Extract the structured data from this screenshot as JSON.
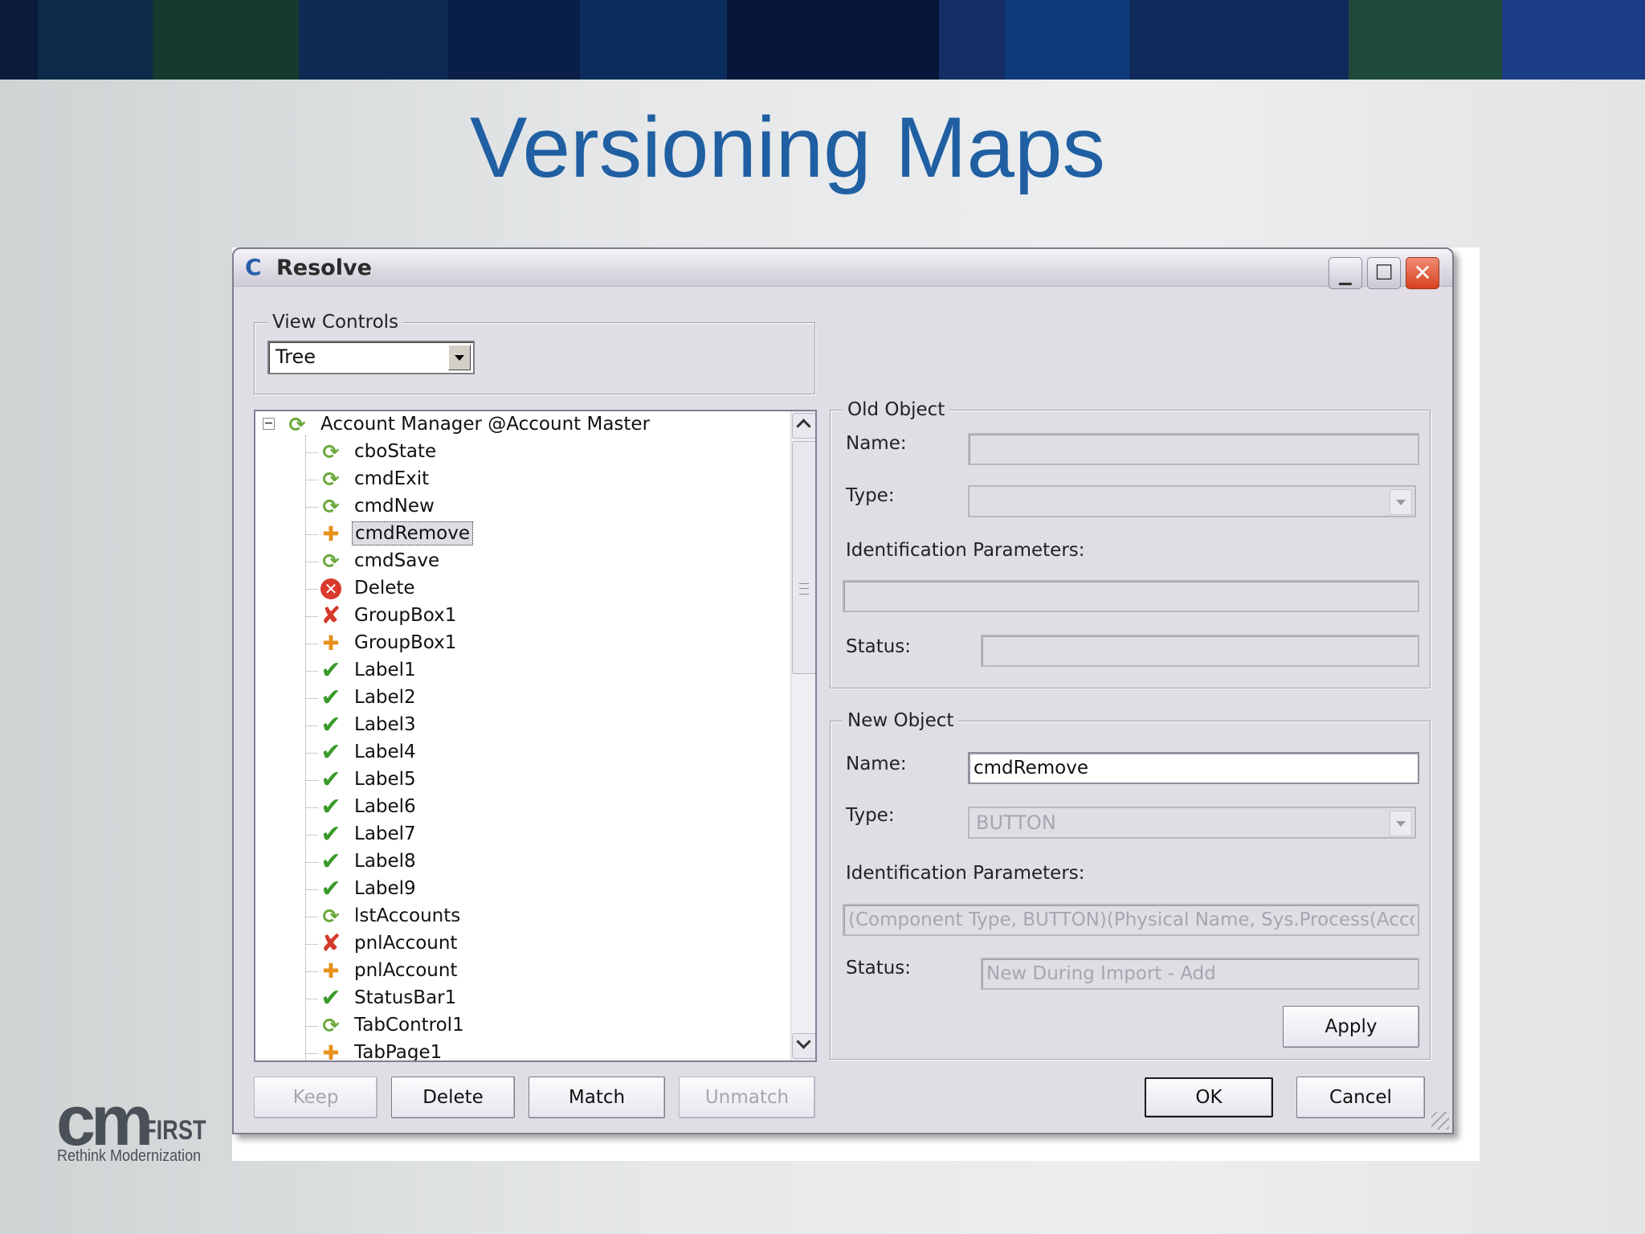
{
  "colors": {
    "band": [
      "#0b1c3a",
      "#0d2a4a",
      "#163a2f",
      "#0f2b54",
      "#0a1f47",
      "#0c2d5e",
      "#07173a",
      "#152f66",
      "#0e3a7a",
      "#102a5c",
      "#1f4a3a",
      "#1a3d86"
    ],
    "title": "#1f5fa2",
    "window_bg": "#e1dde5"
  },
  "slide": {
    "title": "Versioning Maps"
  },
  "logo": {
    "mark": "cm",
    "word": "FIRST",
    "tagline": "Rethink Modernization"
  },
  "window": {
    "title": "Resolve",
    "icon": "app-c-icon",
    "controls": [
      "minimize-icon",
      "maximize-icon",
      "close-icon"
    ]
  },
  "view_controls": {
    "legend": "View Controls",
    "selected": "Tree"
  },
  "tree": {
    "root": {
      "label": "Account Manager @Account Master",
      "icon": "sync-icon",
      "expander": "⊟"
    },
    "items": [
      {
        "label": "cboState",
        "icon": "sync"
      },
      {
        "label": "cmdExit",
        "icon": "sync"
      },
      {
        "label": "cmdNew",
        "icon": "sync"
      },
      {
        "label": "cmdRemove",
        "icon": "plus",
        "selected": true
      },
      {
        "label": "cmdSave",
        "icon": "sync"
      },
      {
        "label": "Delete",
        "icon": "xcircle"
      },
      {
        "label": "GroupBox1",
        "icon": "x"
      },
      {
        "label": "GroupBox1",
        "icon": "plus"
      },
      {
        "label": "Label1",
        "icon": "check"
      },
      {
        "label": "Label2",
        "icon": "check"
      },
      {
        "label": "Label3",
        "icon": "check"
      },
      {
        "label": "Label4",
        "icon": "check"
      },
      {
        "label": "Label5",
        "icon": "check"
      },
      {
        "label": "Label6",
        "icon": "check"
      },
      {
        "label": "Label7",
        "icon": "check"
      },
      {
        "label": "Label8",
        "icon": "check"
      },
      {
        "label": "Label9",
        "icon": "check"
      },
      {
        "label": "lstAccounts",
        "icon": "sync"
      },
      {
        "label": "pnlAccount",
        "icon": "x"
      },
      {
        "label": "pnlAccount",
        "icon": "plus"
      },
      {
        "label": "StatusBar1",
        "icon": "check"
      },
      {
        "label": "TabControl1",
        "icon": "sync"
      },
      {
        "label": "TabPage1",
        "icon": "plus"
      }
    ]
  },
  "old_object": {
    "legend": "Old Object",
    "name_label": "Name:",
    "name_value": "",
    "type_label": "Type:",
    "type_value": "",
    "id_label": "Identification Parameters:",
    "id_value": "",
    "status_label": "Status:",
    "status_value": ""
  },
  "new_object": {
    "legend": "New Object",
    "name_label": "Name:",
    "name_value": "cmdRemove",
    "type_label": "Type:",
    "type_value": "BUTTON",
    "id_label": "Identification Parameters:",
    "id_value": "(Component Type, BUTTON)(Physical Name, Sys.Process(Account M",
    "status_label": "Status:",
    "status_value": "New During Import - Add",
    "apply_label": "Apply"
  },
  "buttons": {
    "keep": "Keep",
    "delete": "Delete",
    "match": "Match",
    "unmatch": "Unmatch",
    "ok": "OK",
    "cancel": "Cancel"
  }
}
